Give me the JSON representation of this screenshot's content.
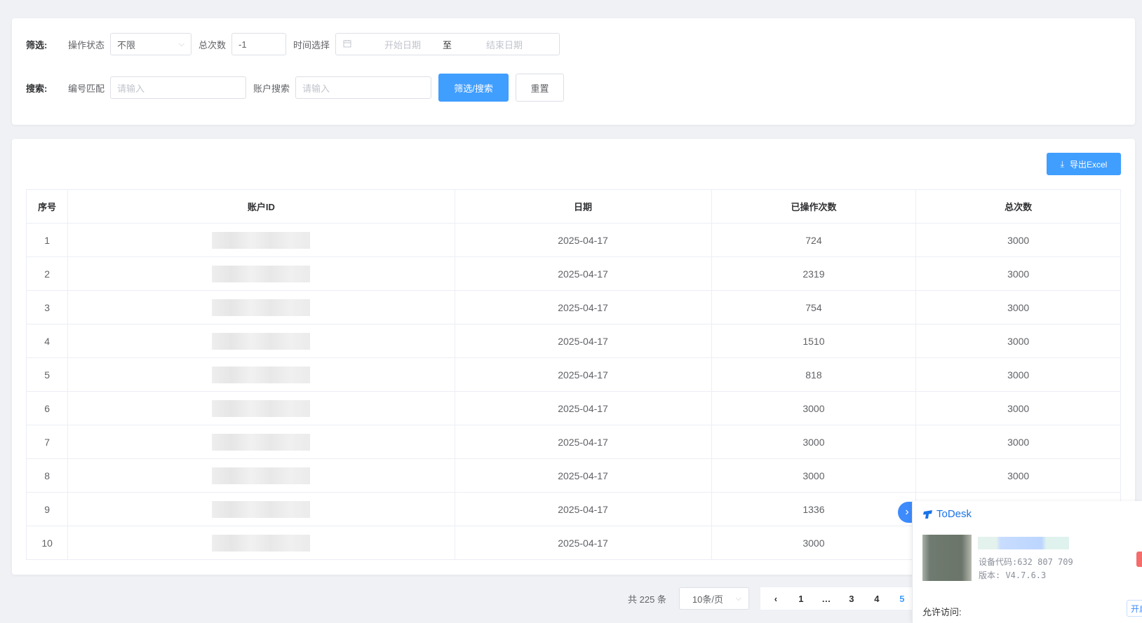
{
  "filter": {
    "row_label": "筛选:",
    "status_label": "操作状态",
    "status_value": "不限",
    "total_label": "总次数",
    "total_value": "-1",
    "time_label": "时间选择",
    "start_placeholder": "开始日期",
    "range_separator": "至",
    "end_placeholder": "结束日期"
  },
  "search": {
    "row_label": "搜索:",
    "code_label": "编号匹配",
    "code_placeholder": "请输入",
    "account_label": "账户搜索",
    "account_placeholder": "请输入",
    "search_button": "筛选/搜索",
    "reset_button": "重置"
  },
  "toolbar": {
    "export_label": "导出Excel"
  },
  "table": {
    "headers": [
      "序号",
      "账户ID",
      "日期",
      "已操作次数",
      "总次数"
    ],
    "rows": [
      {
        "index": "1",
        "date": "2025-04-17",
        "done": "724",
        "total": "3000"
      },
      {
        "index": "2",
        "date": "2025-04-17",
        "done": "2319",
        "total": "3000"
      },
      {
        "index": "3",
        "date": "2025-04-17",
        "done": "754",
        "total": "3000"
      },
      {
        "index": "4",
        "date": "2025-04-17",
        "done": "1510",
        "total": "3000"
      },
      {
        "index": "5",
        "date": "2025-04-17",
        "done": "818",
        "total": "3000"
      },
      {
        "index": "6",
        "date": "2025-04-17",
        "done": "3000",
        "total": "3000"
      },
      {
        "index": "7",
        "date": "2025-04-17",
        "done": "3000",
        "total": "3000"
      },
      {
        "index": "8",
        "date": "2025-04-17",
        "done": "3000",
        "total": "3000"
      },
      {
        "index": "9",
        "date": "2025-04-17",
        "done": "1336",
        "total": ""
      },
      {
        "index": "10",
        "date": "2025-04-17",
        "done": "3000",
        "total": ""
      }
    ]
  },
  "pagination": {
    "total_text": "共 225 条",
    "page_size": "10条/页",
    "pages": [
      "1",
      "…",
      "3",
      "4",
      "5"
    ],
    "active_page": "5"
  },
  "todesk": {
    "brand": "ToDesk",
    "device_code": "设备代码:632 807 709",
    "version": "版本: V4.7.6.3",
    "allow_label": "允许访问:",
    "open_button": "开启"
  },
  "colors": {
    "primary": "#409eff",
    "background": "#eff1f5",
    "todesk_blue": "#1a73e8"
  },
  "icons": [
    "chevron-down-icon",
    "calendar-icon",
    "download-icon",
    "chevron-left-icon",
    "chevron-right-icon",
    "todesk-logo-icon"
  ]
}
